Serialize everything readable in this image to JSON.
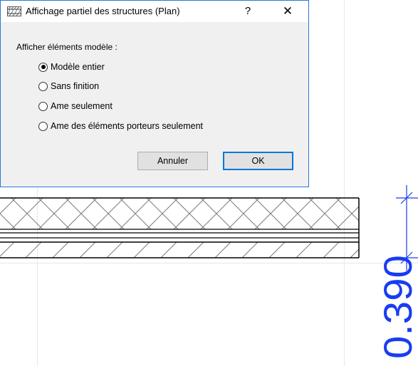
{
  "dialog": {
    "title": "Affichage partiel des structures (Plan)",
    "help_label": "?",
    "close_label": "✕",
    "group_label": "Afficher éléments modèle :",
    "options": [
      {
        "label": "Modèle entier",
        "selected": true
      },
      {
        "label": "Sans finition",
        "selected": false
      },
      {
        "label": "Ame seulement",
        "selected": false
      },
      {
        "label": "Ame des éléments porteurs seulement",
        "selected": false
      }
    ],
    "cancel_label": "Annuler",
    "ok_label": "OK"
  },
  "drawing": {
    "dimension_value": "0.390",
    "dimension_color": "#1a3cf0",
    "wall_line_color": "#000000",
    "hatch_color": "#7a7a7a"
  }
}
